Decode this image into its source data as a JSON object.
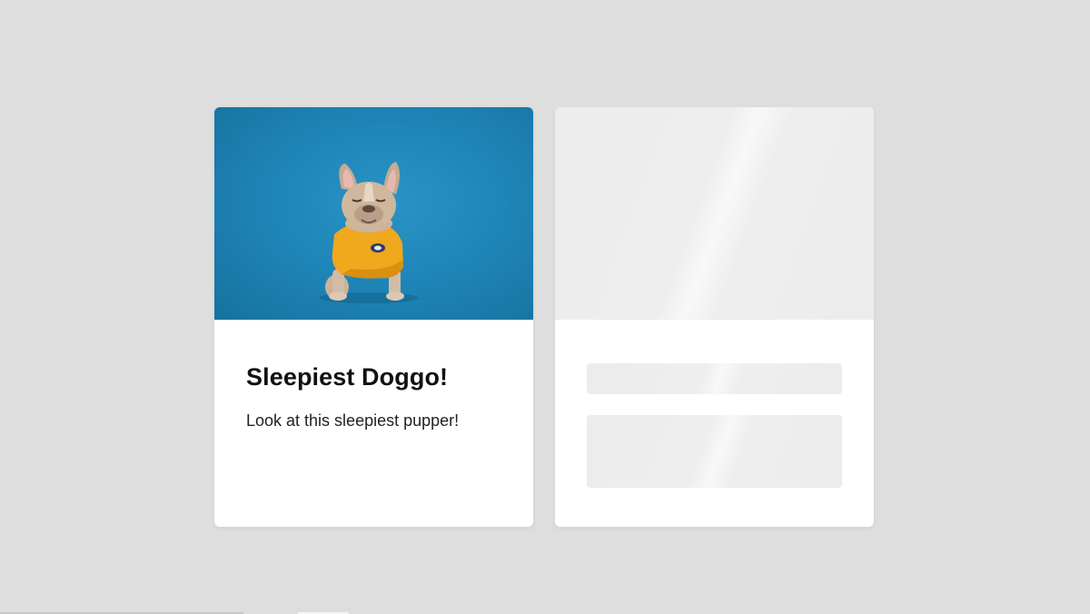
{
  "card": {
    "title": "Sleepiest Doggo!",
    "text": "Look at this sleepiest pupper!",
    "image_subject": "french-bulldog-in-yellow-shirt"
  },
  "skeleton_card": {
    "state": "loading"
  },
  "colors": {
    "page_background": "#dedede",
    "card_background": "#ffffff",
    "image_background": "#1f86b9",
    "skeleton": "#ececec",
    "shirt": "#f0a81c"
  }
}
